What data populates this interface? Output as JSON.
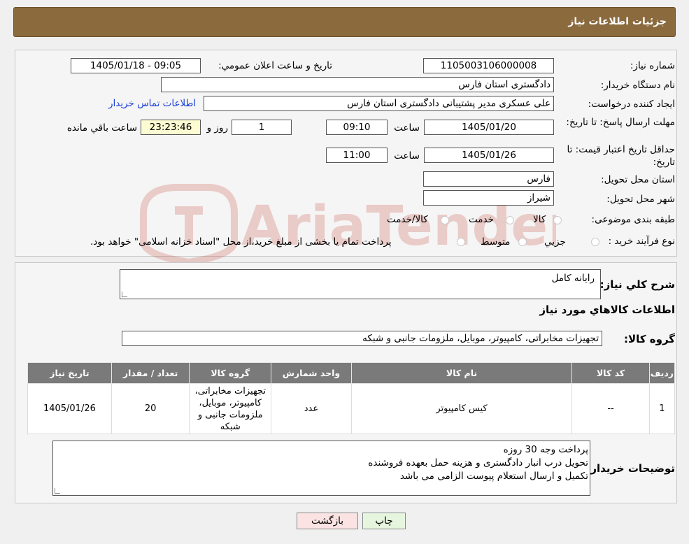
{
  "header": {
    "title": "جزئیات اطلاعات نیاز"
  },
  "form": {
    "need_number_label": "شماره نیاز:",
    "need_number": "1105003106000008",
    "announce_label": "تاريخ و ساعت اعلان عمومي:",
    "announce_value": "1405/01/18 - 09:05",
    "buyer_org_label": "نام دستگاه خريدار:",
    "buyer_org": "دادگستری استان فارس",
    "requester_label": "ايجاد کننده درخواست:",
    "requester": "علی عسکری مدیر پشتیبانی دادگستری استان فارس",
    "contact_link": "اطلاعات تماس خريدار",
    "deadline_label": "مهلت ارسال پاسخ: تا تاريخ:",
    "deadline_date": "1405/01/20",
    "time_label": "ساعت",
    "deadline_time": "09:10",
    "days": "1",
    "days_label": "روز و",
    "remaining": "23:23:46",
    "remaining_label": "ساعت باقي مانده",
    "validity_label": "حداقل تاريخ اعتبار قيمت: تا تاريخ:",
    "validity_date": "1405/01/26",
    "validity_time": "11:00",
    "province_label": "استان محل تحويل:",
    "province": "فارس",
    "city_label": "شهر محل تحويل:",
    "city": "شیراز",
    "category_label": "طبقه بندی موضوعی:",
    "category_options": [
      "کالا",
      "خدمت",
      "کالا/خدمت"
    ],
    "process_label": "نوع فرآيند خريد :",
    "process_options": [
      "جزیي",
      "متوسط"
    ],
    "process_note": "پرداخت تمام یا بخشی از مبلغ خرید،از محل \"اسناد خزانه اسلامی\" خواهد بود."
  },
  "details": {
    "summary_label": "شرح كلي نياز:",
    "summary": "رایانه کامل",
    "goods_info_title": "اطلاعات كالاهاي مورد نياز",
    "goods_group_label": "گروه كالا:",
    "goods_group": "تجهیزات مخابراتی، کامپیوتر، موبایل، ملزومات جانبی و شبکه",
    "table": {
      "headers": [
        "رديف",
        "كد كالا",
        "نام كالا",
        "واحد شمارش",
        "گروه كالا",
        "تعداد / مقدار",
        "تاريخ نياز"
      ],
      "rows": [
        [
          "1",
          "--",
          "کیس کامپیوتر",
          "عدد",
          "تجهیزات مخابراتی، کامپیوتر، موبایل، ملزومات جانبی و شبکه",
          "20",
          "1405/01/26"
        ]
      ]
    },
    "buyer_notes_label": "توضيحات خريدار:",
    "buyer_notes": [
      "پرداخت وجه 30 روزه",
      "تحویل درب انبار دادگستری و هزینه حمل بعهده فروشنده",
      "تکمیل و ارسال استعلام پیوست الزامی می باشد"
    ]
  },
  "buttons": {
    "print": "چاپ",
    "back": "بازگشت"
  },
  "watermark": {
    "text": "AriaTender.neT"
  },
  "colors": {
    "header_bg": "#8b6a3e",
    "link": "#1a3fd6",
    "back_button": "#fbe3e3",
    "print_button": "#e6f6de"
  }
}
